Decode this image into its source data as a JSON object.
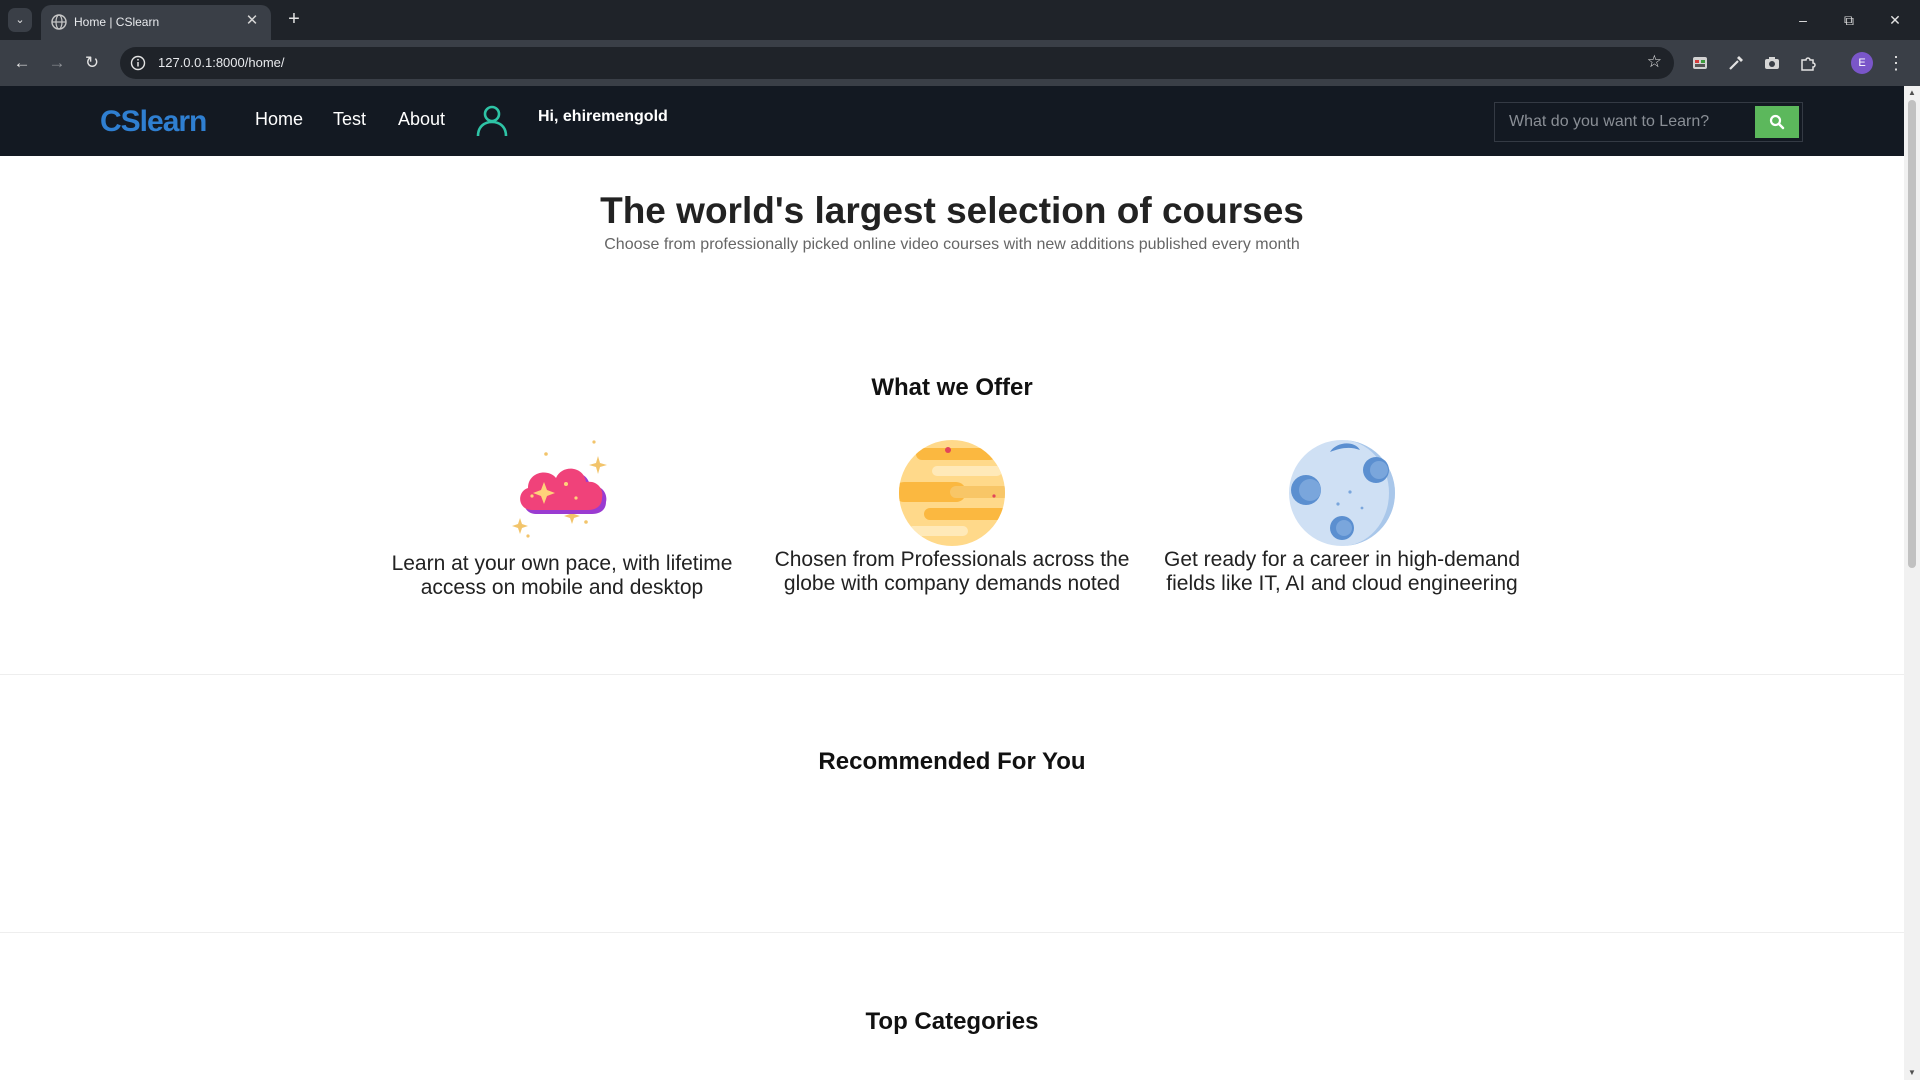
{
  "browser": {
    "tab_title": "Home | CSlearn",
    "url": "127.0.0.1:8000/home/",
    "profile_initial": "E"
  },
  "site": {
    "brand": "CSlearn",
    "nav": [
      {
        "label": "Home"
      },
      {
        "label": "Test"
      },
      {
        "label": "About"
      }
    ],
    "greeting": "Hi, ehiremengold",
    "search": {
      "placeholder": "What do you want to Learn?",
      "value": ""
    },
    "colors": {
      "navbar": "#131922",
      "brand": "#2f7fd1",
      "search_button": "#5cb85c",
      "user_icon": "#2ec4a6"
    }
  },
  "hero": {
    "title": "The world's largest selection of courses",
    "subtitle": "Choose from professionally picked online video courses with new additions published every month"
  },
  "offer": {
    "title": "What we Offer",
    "items": [
      {
        "text": "Learn at your own pace, with lifetime access on mobile and desktop",
        "icon": "pink-cloud-icon"
      },
      {
        "text": "Chosen from Professionals across the globe with company demands noted",
        "icon": "striped-planet-icon"
      },
      {
        "text": "Get ready for a career in high-demand fields like IT, AI and cloud engineering",
        "icon": "moon-icon"
      }
    ]
  },
  "recommended": {
    "title": "Recommended For You"
  },
  "categories": {
    "title": "Top Categories"
  }
}
